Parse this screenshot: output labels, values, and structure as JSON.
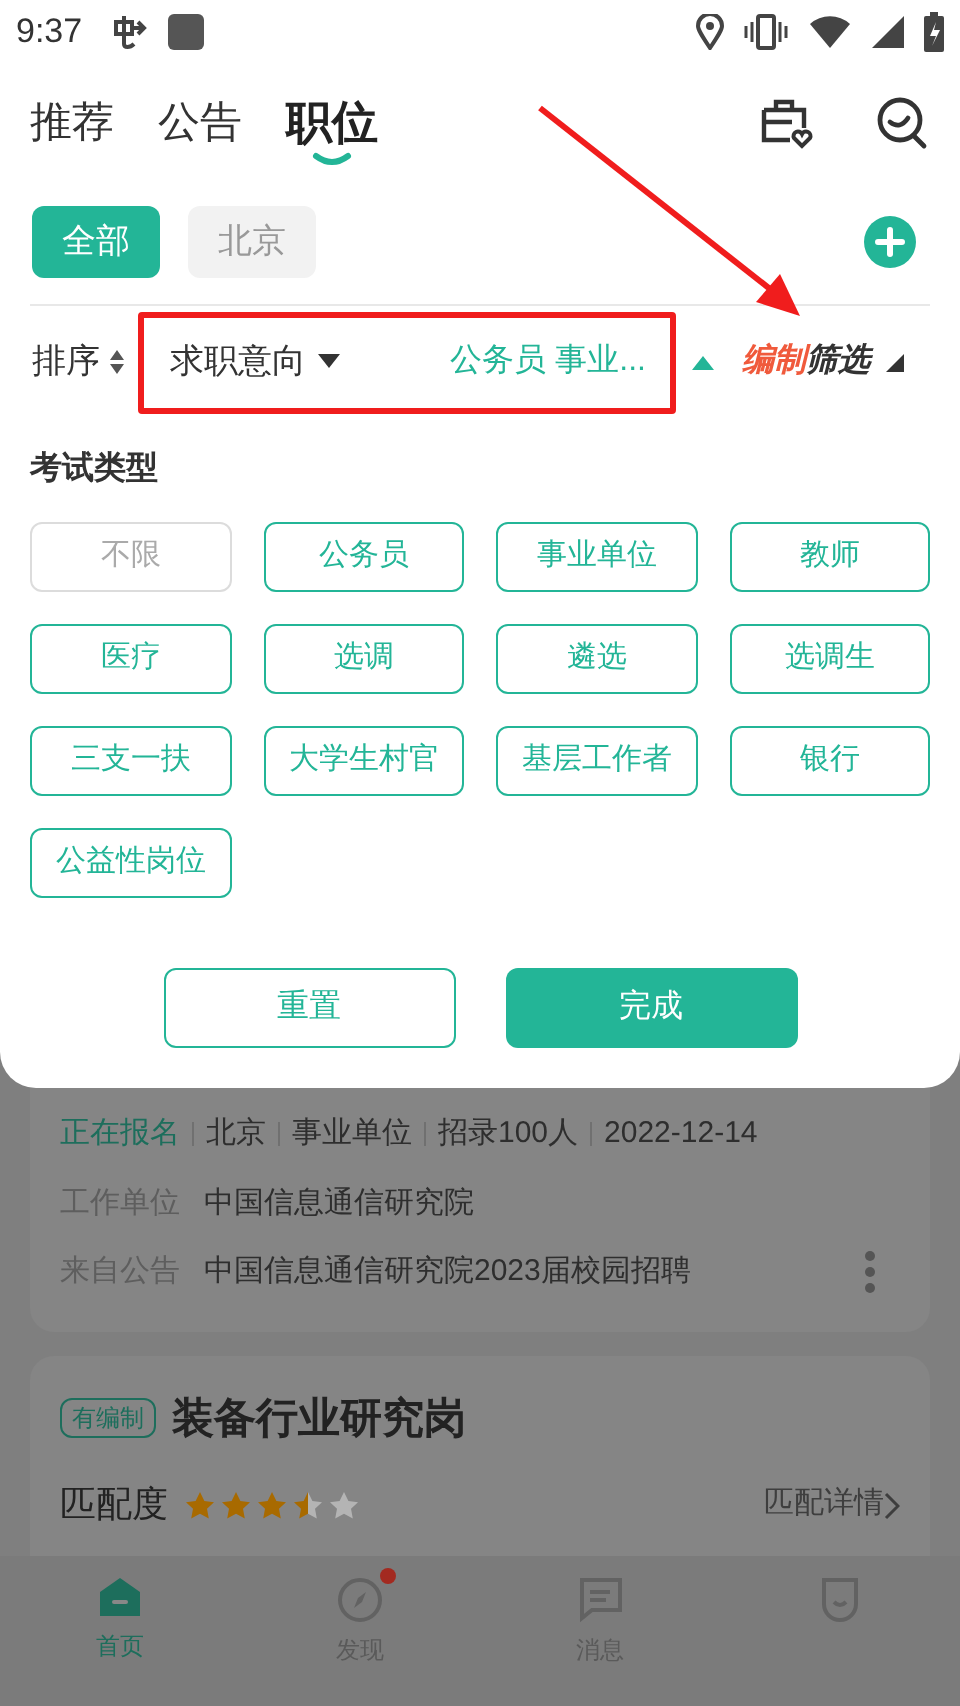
{
  "status_bar": {
    "time": "9:37"
  },
  "tabs": [
    {
      "label": "推荐",
      "selected": false
    },
    {
      "label": "公告",
      "selected": false
    },
    {
      "label": "职位",
      "selected": true
    }
  ],
  "regions": [
    {
      "label": "全部",
      "selected": true
    },
    {
      "label": "北京",
      "selected": false
    }
  ],
  "filter_bar": {
    "sort": "排序",
    "intent": "求职意向",
    "intent_value": "公务员 事业...",
    "filter_highlight": "编制",
    "filter_label": "筛选"
  },
  "filter_panel": {
    "title": "考试类型",
    "options": [
      {
        "label": "不限",
        "selected": false
      },
      {
        "label": "公务员",
        "selected": true
      },
      {
        "label": "事业单位",
        "selected": true
      },
      {
        "label": "教师",
        "selected": true
      },
      {
        "label": "医疗",
        "selected": true
      },
      {
        "label": "选调",
        "selected": true
      },
      {
        "label": "遴选",
        "selected": true
      },
      {
        "label": "选调生",
        "selected": true
      },
      {
        "label": "三支一扶",
        "selected": true
      },
      {
        "label": "大学生村官",
        "selected": true
      },
      {
        "label": "基层工作者",
        "selected": true
      },
      {
        "label": "银行",
        "selected": true
      },
      {
        "label": "公益性岗位",
        "selected": true
      }
    ],
    "reset": "重置",
    "done": "完成"
  },
  "jobs": [
    {
      "status": "正在报名",
      "meta": [
        "北京",
        "事业单位",
        "招录100人",
        "2022-12-14"
      ],
      "details": [
        {
          "label": "工作单位",
          "value": "中国信息通信研究院"
        },
        {
          "label": "来自公告",
          "value": "中国信息通信研究院2023届校园招聘"
        }
      ]
    },
    {
      "tag": "有编制",
      "title": "装备行业研究岗",
      "match_label": "匹配度",
      "stars": 3.5,
      "match_link": "匹配详情"
    }
  ],
  "bottom_nav": [
    {
      "label": "首页",
      "selected": true,
      "badge": false
    },
    {
      "label": "发现",
      "selected": false,
      "badge": true
    },
    {
      "label": "消息",
      "selected": false,
      "badge": false
    },
    {
      "selected": false,
      "badge": false
    }
  ]
}
